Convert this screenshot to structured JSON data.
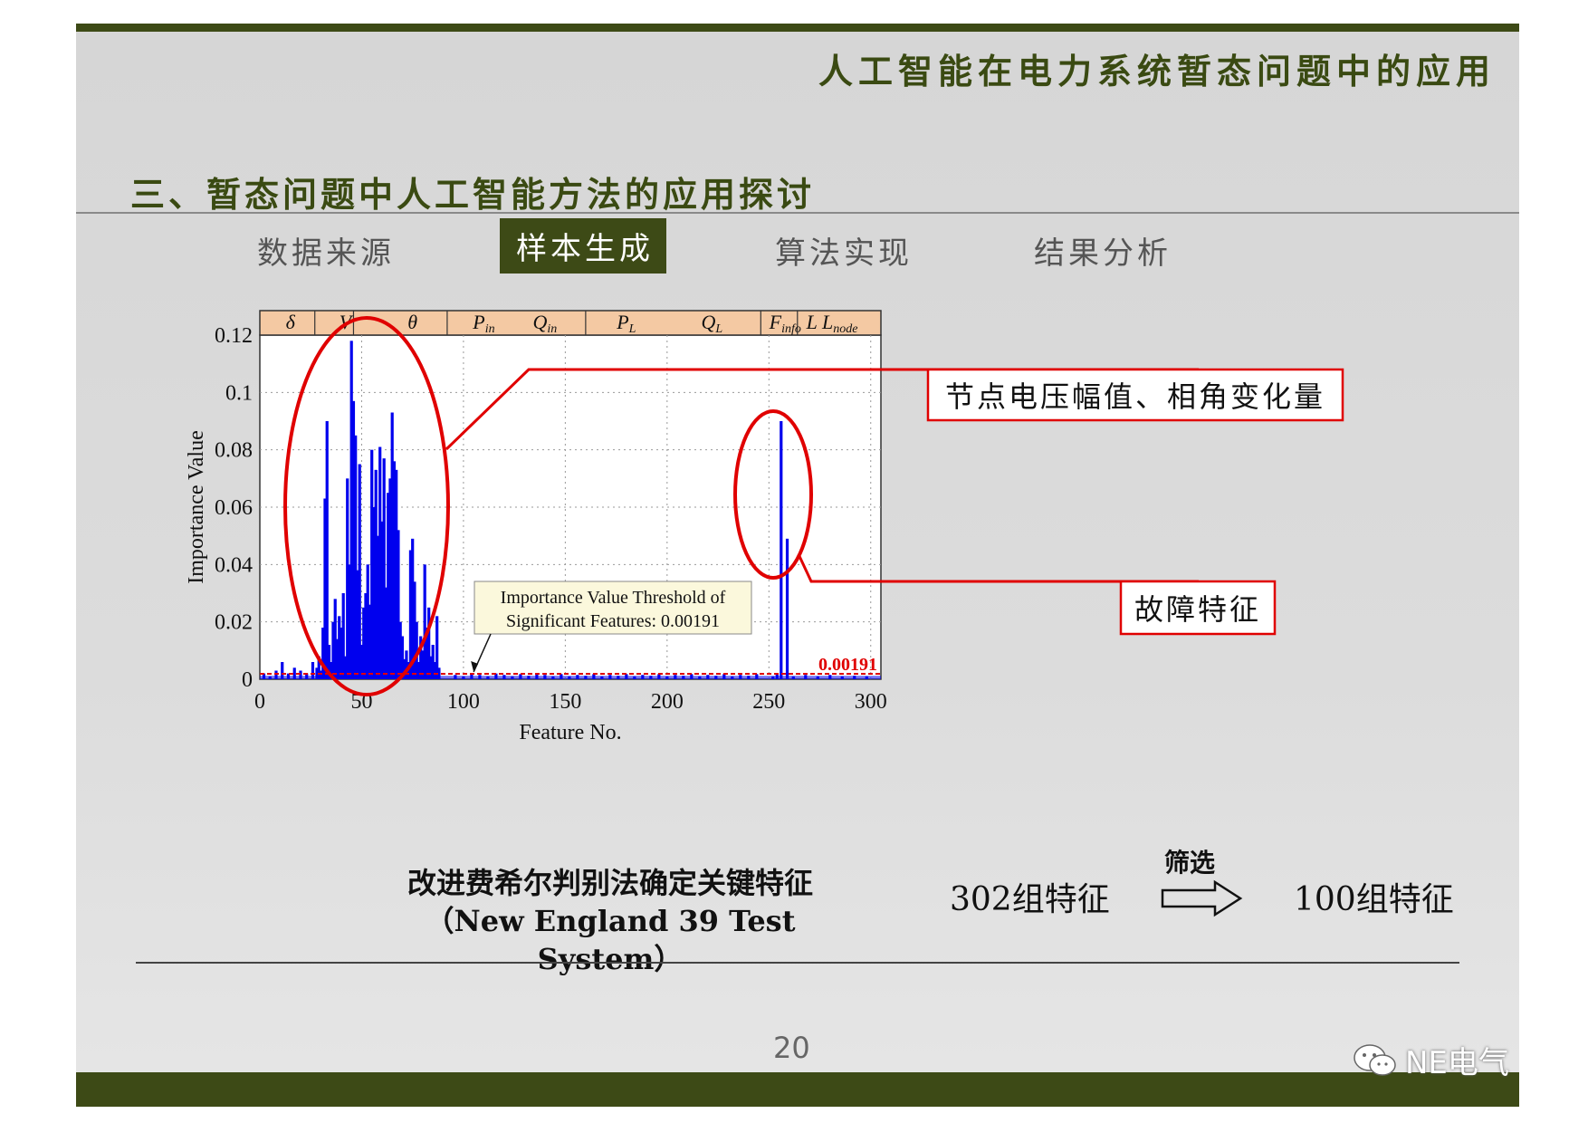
{
  "header": {
    "title": "人工智能在电力系统暂态问题中的应用"
  },
  "section": {
    "title": "三、暂态问题中人工智能方法的应用探讨"
  },
  "tabs": [
    {
      "label": "数据来源",
      "active": false
    },
    {
      "label": "样本生成",
      "active": true
    },
    {
      "label": "算法实现",
      "active": false
    },
    {
      "label": "结果分析",
      "active": false
    }
  ],
  "colors": {
    "accent": "#3d4a16",
    "bar": "#0000ee",
    "highlight": "#e00000"
  },
  "chart_data": {
    "type": "bar",
    "xlabel": "Feature No.",
    "ylabel": "Importance Value",
    "xlim": [
      0,
      305
    ],
    "ylim": [
      0,
      0.12
    ],
    "xticks": [
      "0",
      "50",
      "100",
      "150",
      "200",
      "250",
      "300"
    ],
    "yticks": [
      "0",
      "0.02",
      "0.04",
      "0.06",
      "0.08",
      "0.1",
      "0.12"
    ],
    "grid": true,
    "group_labels": [
      {
        "text": "δ",
        "sub": "",
        "x": 15
      },
      {
        "text": "V",
        "sub": "",
        "x": 42
      },
      {
        "text": "θ",
        "sub": "",
        "x": 75
      },
      {
        "text": "P",
        "sub": "in",
        "x": 110
      },
      {
        "text": "Q",
        "sub": "in",
        "x": 140
      },
      {
        "text": "P",
        "sub": "L",
        "x": 180
      },
      {
        "text": "Q",
        "sub": "L",
        "x": 222
      },
      {
        "text": "F",
        "sub": "info",
        "x": 258
      },
      {
        "text": "L L",
        "sub": "node",
        "x": 281
      }
    ],
    "group_boundaries": [
      27,
      46,
      92,
      160,
      246,
      264
    ],
    "threshold": {
      "value": 0.00191,
      "label": "0.00191"
    },
    "annotation": {
      "line1": "Importance Value Threshold of",
      "line2": "Significant Features: 0.00191",
      "target_x": 105
    },
    "bars": [
      [
        2,
        0.002
      ],
      [
        5,
        0.001
      ],
      [
        8,
        0.003
      ],
      [
        11,
        0.006
      ],
      [
        14,
        0.002
      ],
      [
        17,
        0.004
      ],
      [
        20,
        0.003
      ],
      [
        23,
        0.002
      ],
      [
        26,
        0.006
      ],
      [
        28,
        0.004
      ],
      [
        29,
        0.008
      ],
      [
        30,
        0.003
      ],
      [
        31,
        0.018
      ],
      [
        32,
        0.063
      ],
      [
        33,
        0.09
      ],
      [
        34,
        0.012
      ],
      [
        35,
        0.006
      ],
      [
        36,
        0.02
      ],
      [
        37,
        0.028
      ],
      [
        38,
        0.014
      ],
      [
        39,
        0.022
      ],
      [
        40,
        0.018
      ],
      [
        41,
        0.03
      ],
      [
        42,
        0.008
      ],
      [
        43,
        0.07
      ],
      [
        44,
        0.04
      ],
      [
        45,
        0.118
      ],
      [
        46,
        0.097
      ],
      [
        47,
        0.085
      ],
      [
        48,
        0.038
      ],
      [
        49,
        0.075
      ],
      [
        50,
        0.012
      ],
      [
        51,
        0.025
      ],
      [
        52,
        0.03
      ],
      [
        53,
        0.04
      ],
      [
        54,
        0.026
      ],
      [
        55,
        0.08
      ],
      [
        56,
        0.06
      ],
      [
        57,
        0.073
      ],
      [
        58,
        0.05
      ],
      [
        59,
        0.081
      ],
      [
        60,
        0.055
      ],
      [
        61,
        0.077
      ],
      [
        62,
        0.032
      ],
      [
        63,
        0.065
      ],
      [
        64,
        0.07
      ],
      [
        65,
        0.093
      ],
      [
        66,
        0.076
      ],
      [
        67,
        0.073
      ],
      [
        68,
        0.052
      ],
      [
        69,
        0.02
      ],
      [
        70,
        0.015
      ],
      [
        71,
        0.007
      ],
      [
        72,
        0.01
      ],
      [
        73,
        0.006
      ],
      [
        74,
        0.045
      ],
      [
        75,
        0.049
      ],
      [
        76,
        0.034
      ],
      [
        77,
        0.02
      ],
      [
        78,
        0.006
      ],
      [
        79,
        0.015
      ],
      [
        80,
        0.01
      ],
      [
        81,
        0.04
      ],
      [
        82,
        0.018
      ],
      [
        83,
        0.025
      ],
      [
        84,
        0.008
      ],
      [
        85,
        0.012
      ],
      [
        86,
        0.006
      ],
      [
        87,
        0.022
      ],
      [
        88,
        0.004
      ],
      [
        96,
        0.0015
      ],
      [
        100,
        0.001
      ],
      [
        104,
        0.002
      ],
      [
        108,
        0.0015
      ],
      [
        112,
        0.001
      ],
      [
        116,
        0.002
      ],
      [
        120,
        0.0015
      ],
      [
        124,
        0.001
      ],
      [
        128,
        0.0018
      ],
      [
        132,
        0.0012
      ],
      [
        136,
        0.002
      ],
      [
        140,
        0.0015
      ],
      [
        144,
        0.001
      ],
      [
        148,
        0.0018
      ],
      [
        152,
        0.001
      ],
      [
        156,
        0.0015
      ],
      [
        160,
        0.0012
      ],
      [
        164,
        0.0018
      ],
      [
        168,
        0.001
      ],
      [
        172,
        0.0015
      ],
      [
        176,
        0.0012
      ],
      [
        180,
        0.0018
      ],
      [
        184,
        0.001
      ],
      [
        188,
        0.0015
      ],
      [
        192,
        0.0012
      ],
      [
        196,
        0.0018
      ],
      [
        200,
        0.001
      ],
      [
        204,
        0.0015
      ],
      [
        208,
        0.0012
      ],
      [
        212,
        0.0018
      ],
      [
        216,
        0.001
      ],
      [
        220,
        0.0015
      ],
      [
        224,
        0.0012
      ],
      [
        228,
        0.0018
      ],
      [
        232,
        0.001
      ],
      [
        236,
        0.0015
      ],
      [
        240,
        0.0012
      ],
      [
        244,
        0.0018
      ],
      [
        252,
        0.001
      ],
      [
        254,
        0.002
      ],
      [
        256,
        0.09
      ],
      [
        259,
        0.049
      ],
      [
        262,
        0.001
      ],
      [
        268,
        0.0015
      ],
      [
        274,
        0.001
      ],
      [
        280,
        0.0015
      ],
      [
        286,
        0.001
      ],
      [
        292,
        0.0012
      ],
      [
        298,
        0.001
      ]
    ]
  },
  "callouts": {
    "voltage": "节点电压幅值、相角变化量",
    "fault": "故障特征"
  },
  "caption": {
    "line1": "改进费希尔判别法确定关键特征",
    "line2": "（New England 39 Test System）"
  },
  "features": {
    "from": "302组特征",
    "filter_label": "筛选",
    "to": "100组特征"
  },
  "footer": {
    "page_number": "20",
    "brand": "NE电气"
  }
}
